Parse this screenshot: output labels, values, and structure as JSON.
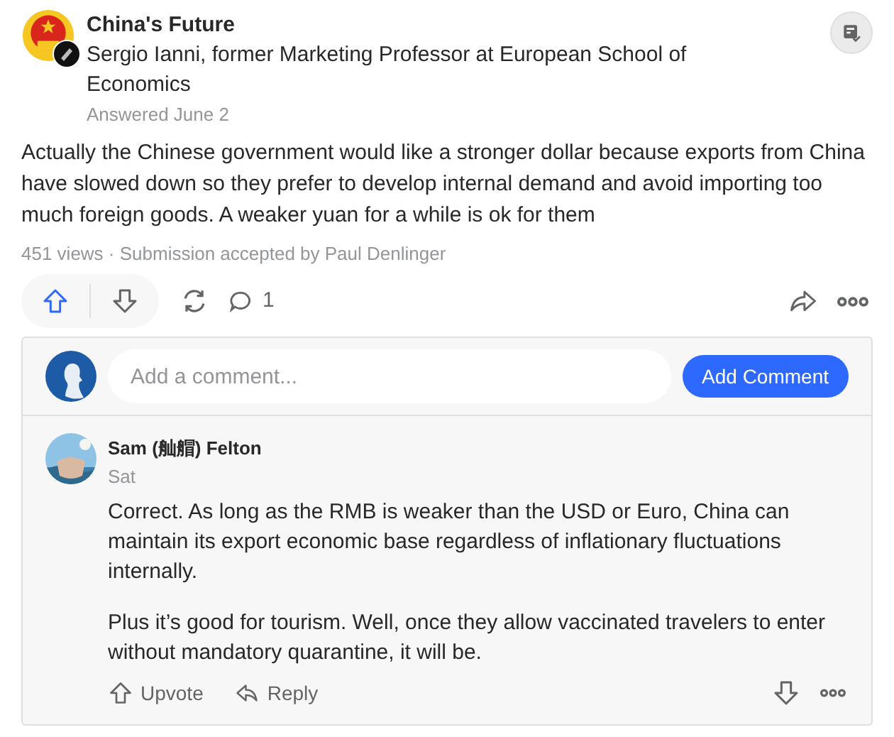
{
  "space": {
    "name": "China's Future"
  },
  "author": {
    "credential": "Sergio Ianni, former Marketing Professor at European School of Economics",
    "date": "Answered June 2"
  },
  "answer": {
    "text": "Actually the Chinese government would like a stronger dollar because exports from China have slowed down so they prefer to develop internal demand and avoid importing too much foreign goods. A weaker yuan for a while is ok for them"
  },
  "stats": "451 views · Submission accepted by Paul Denlinger",
  "actions": {
    "upvoted": true,
    "downvoted": false,
    "comment_count": "1"
  },
  "comment_box": {
    "placeholder": "Add a comment...",
    "button": "Add Comment"
  },
  "comments": [
    {
      "author": "Sam (舢艒) Felton",
      "date": "Sat",
      "paragraphs": [
        "Correct. As long as the RMB is weaker than the USD or Euro, China can maintain its export economic base regardless of inflationary fluctuations internally.",
        "Plus it’s good for tourism. Well, once they allow vaccinated travelers to enter without mandatory quarantine, it will be."
      ],
      "upvote": "Upvote",
      "reply": "Reply",
      "upvoted": false
    }
  ]
}
